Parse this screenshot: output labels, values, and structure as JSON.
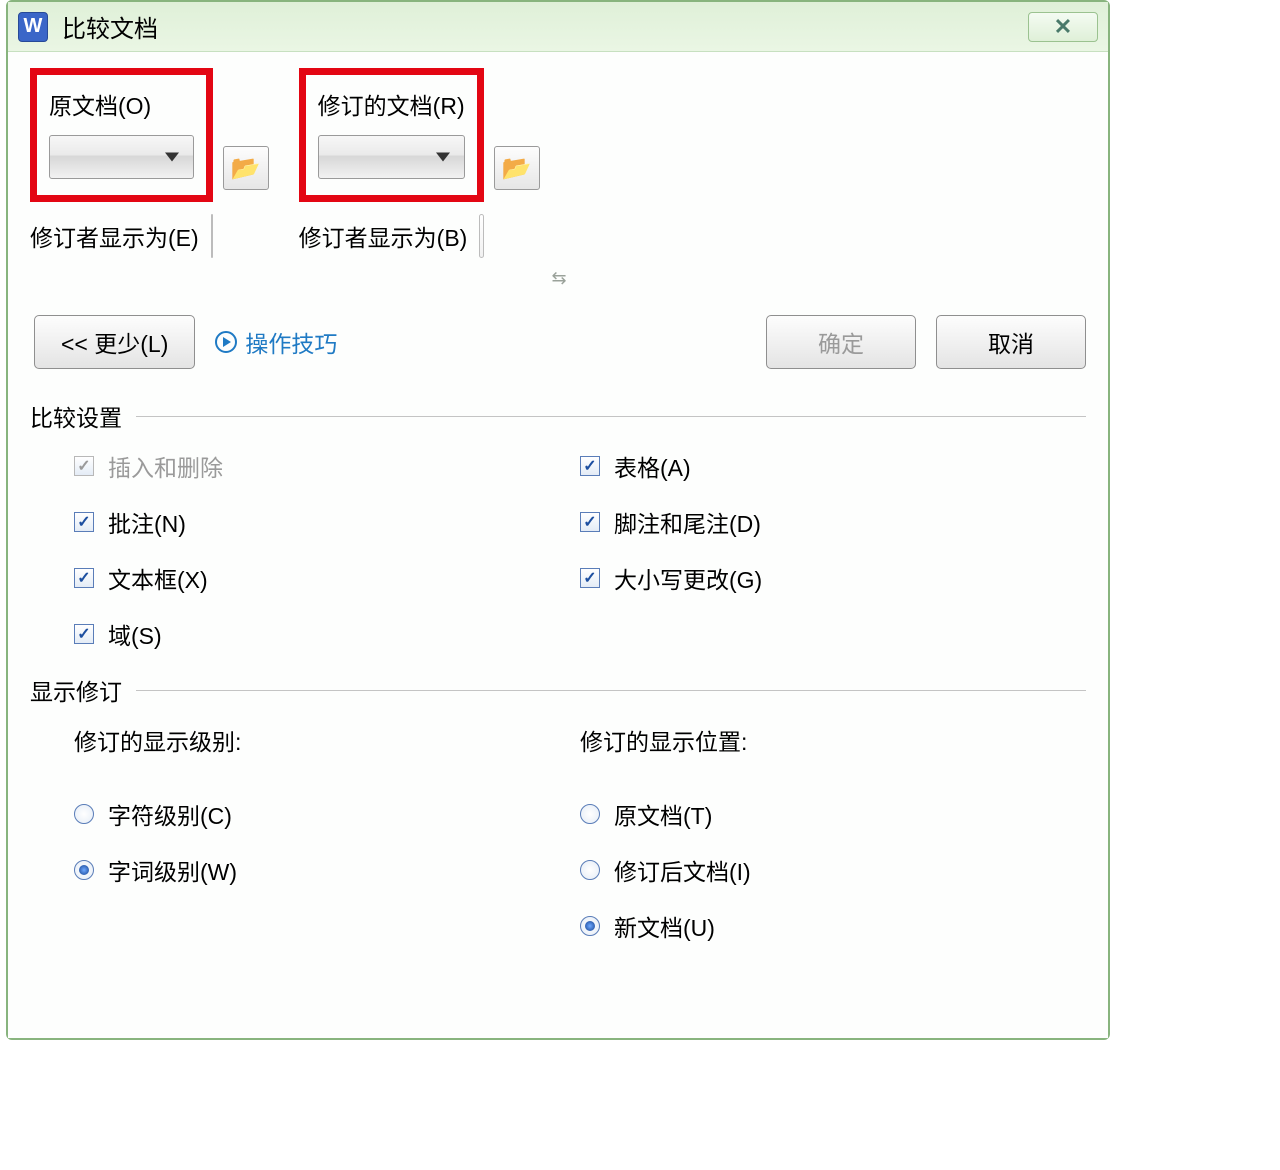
{
  "window": {
    "app_letter": "W",
    "title": "比较文档",
    "close": "✕"
  },
  "original": {
    "label": "原文档(O)",
    "editor_label": "修订者显示为(E)"
  },
  "revised": {
    "label": "修订的文档(R)",
    "editor_label": "修订者显示为(B)"
  },
  "swap_icon": "⇆",
  "actions": {
    "less": "<<  更少(L)",
    "tips": "操作技巧",
    "ok": "确定",
    "cancel": "取消"
  },
  "compare_settings": {
    "title": "比较设置",
    "left": {
      "inserts_deletes": "插入和删除",
      "comments": "批注(N)",
      "textboxes": "文本框(X)",
      "fields": "域(S)"
    },
    "right": {
      "tables": "表格(A)",
      "footnotes": "脚注和尾注(D)",
      "case_changes": "大小写更改(G)"
    }
  },
  "show_changes": {
    "title": "显示修订",
    "level_label": "修订的显示级别:",
    "location_label": "修订的显示位置:",
    "levels": {
      "char": "字符级别(C)",
      "word": "字词级别(W)"
    },
    "locations": {
      "original": "原文档(T)",
      "revised": "修订后文档(I)",
      "new_doc": "新文档(U)"
    }
  }
}
